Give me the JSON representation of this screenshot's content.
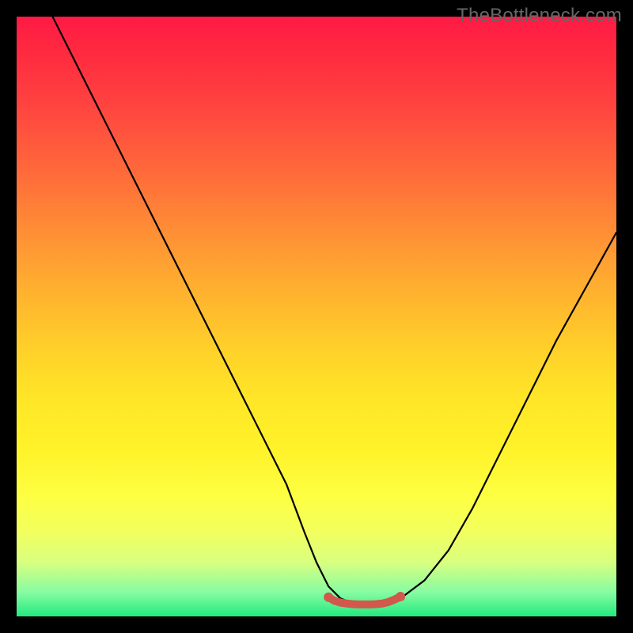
{
  "watermark": "TheBottleneck.com",
  "chart_data": {
    "type": "line",
    "title": "",
    "xlabel": "",
    "ylabel": "",
    "xlim": [
      0,
      100
    ],
    "ylim": [
      0,
      100
    ],
    "series": [
      {
        "name": "curve",
        "x": [
          6,
          10,
          15,
          20,
          25,
          30,
          35,
          40,
          45,
          48,
          50,
          52,
          54,
          56,
          58,
          60,
          62,
          64,
          68,
          72,
          76,
          80,
          85,
          90,
          95,
          100
        ],
        "y": [
          100,
          92,
          82,
          72,
          62,
          52,
          42,
          32,
          22,
          14,
          9,
          5,
          3,
          2.2,
          2,
          2,
          2.2,
          3,
          6,
          11,
          18,
          26,
          36,
          46,
          55,
          64
        ]
      },
      {
        "name": "bottom-marker",
        "x": [
          52,
          53,
          54,
          55,
          56,
          57,
          58,
          59,
          60,
          61,
          62,
          63,
          64
        ],
        "y": [
          3.2,
          2.6,
          2.3,
          2.15,
          2.05,
          2.0,
          2.0,
          2.0,
          2.05,
          2.15,
          2.4,
          2.8,
          3.3
        ]
      }
    ],
    "annotations": [],
    "colors": {
      "curve": "#000000",
      "marker": "#d1584c",
      "gradient_top": "#ff1a45",
      "gradient_bottom": "#24e97f"
    }
  }
}
